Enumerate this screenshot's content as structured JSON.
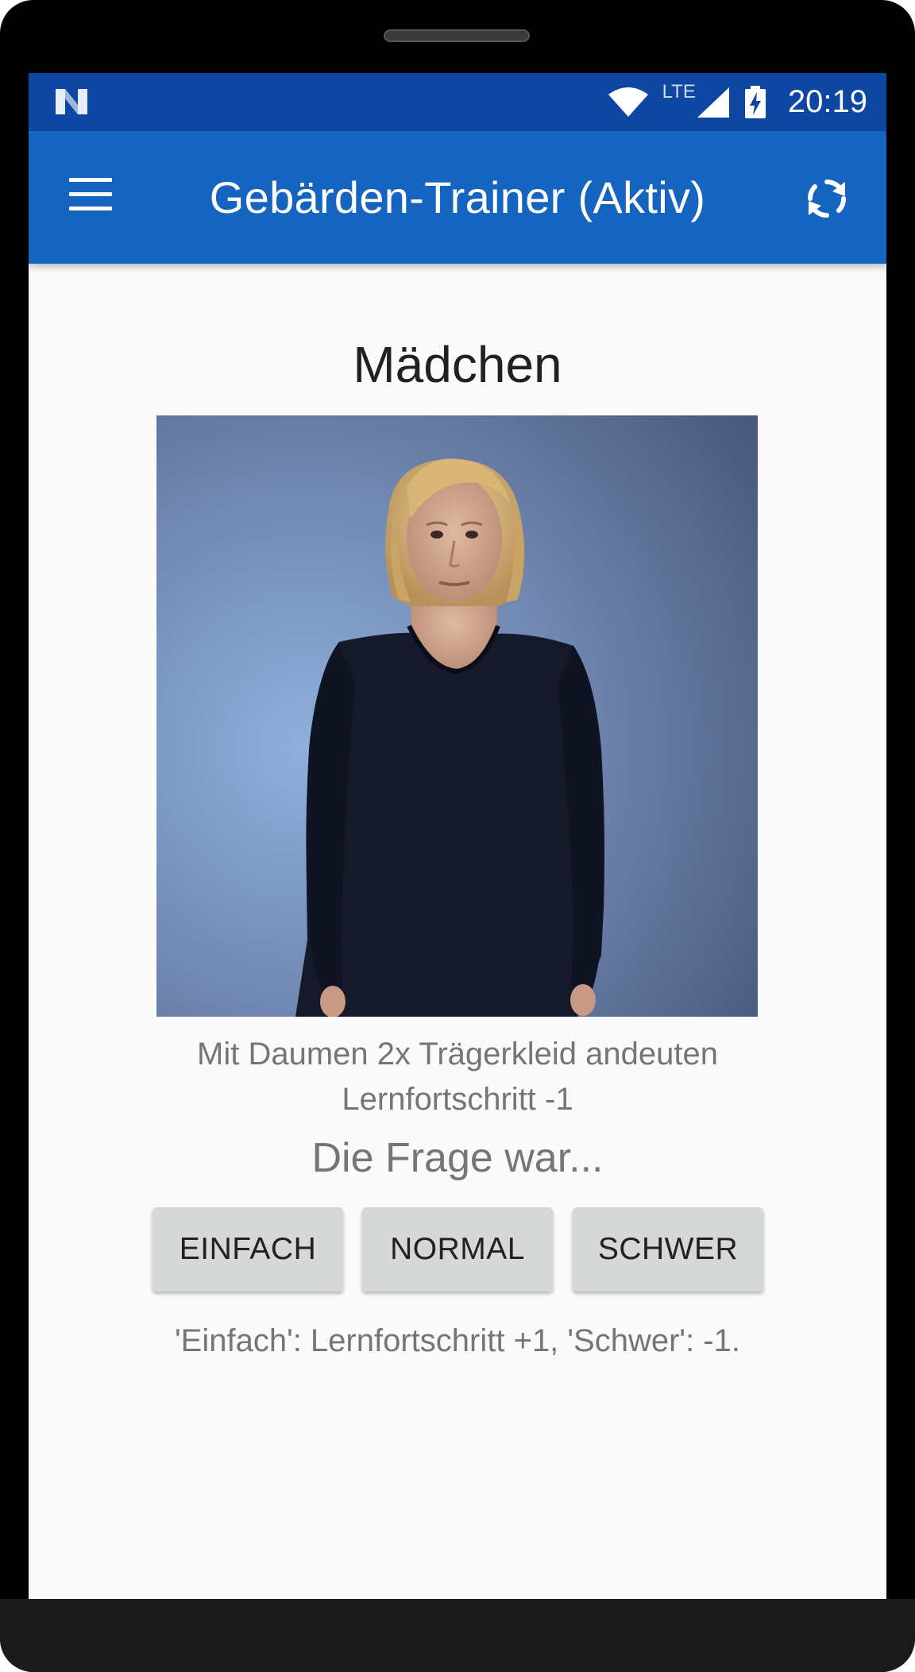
{
  "status_bar": {
    "network_label": "LTE",
    "time": "20:19",
    "icons": [
      "notification-n-icon",
      "wifi-icon",
      "cell-signal-icon",
      "battery-charging-icon"
    ],
    "color": "#0d47a1"
  },
  "toolbar": {
    "title": "Gebärden-Trainer (Aktiv)",
    "menu_icon": "hamburger-menu-icon",
    "refresh_icon": "refresh-icon",
    "color": "#1565c0"
  },
  "card": {
    "word": "Mädchen",
    "description": "Mit Daumen 2x Trägerkleid andeuten",
    "progress": "Lernfortschritt -1",
    "question": "Die Frage war..."
  },
  "buttons": {
    "easy": "EINFACH",
    "normal": "NORMAL",
    "hard": "SCHWER"
  },
  "hint": "'Einfach': Lernfortschritt +1, 'Schwer': -1."
}
